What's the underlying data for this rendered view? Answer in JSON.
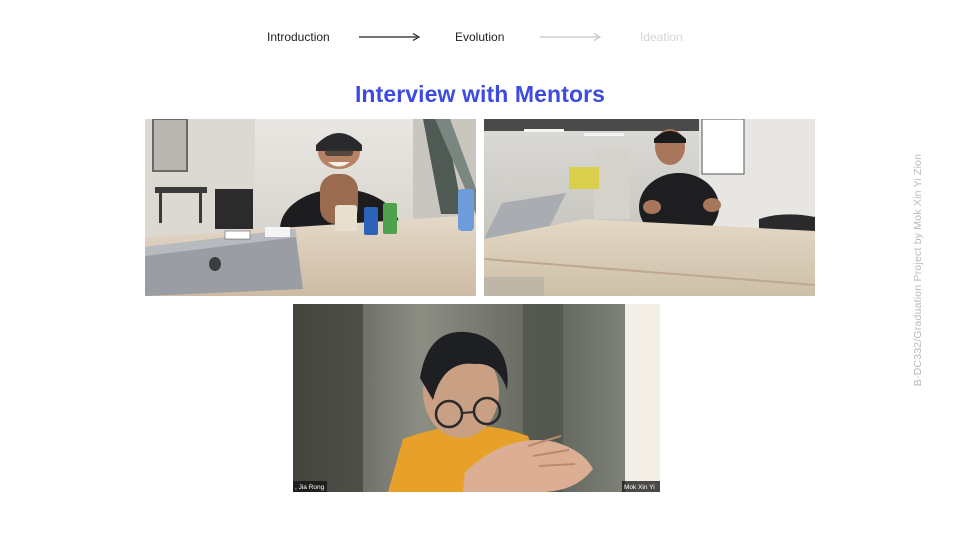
{
  "progress": {
    "steps": [
      {
        "label": "Introduction",
        "state": "active"
      },
      {
        "label": "Evolution",
        "state": "active"
      },
      {
        "label": "Ideation",
        "state": "inactive"
      }
    ]
  },
  "title": "Interview with Mentors",
  "photos": {
    "video_call": {
      "left_name": ", Jia Rong",
      "right_name": "Mok Xin Yi"
    }
  },
  "credit": "B-DC332/Graduation Project by Mok Xin Yi Zion",
  "colors": {
    "title": "#3d4be0",
    "step_active": "#222222",
    "step_inactive": "#d6d6d6",
    "credit": "#b9b9b9"
  }
}
